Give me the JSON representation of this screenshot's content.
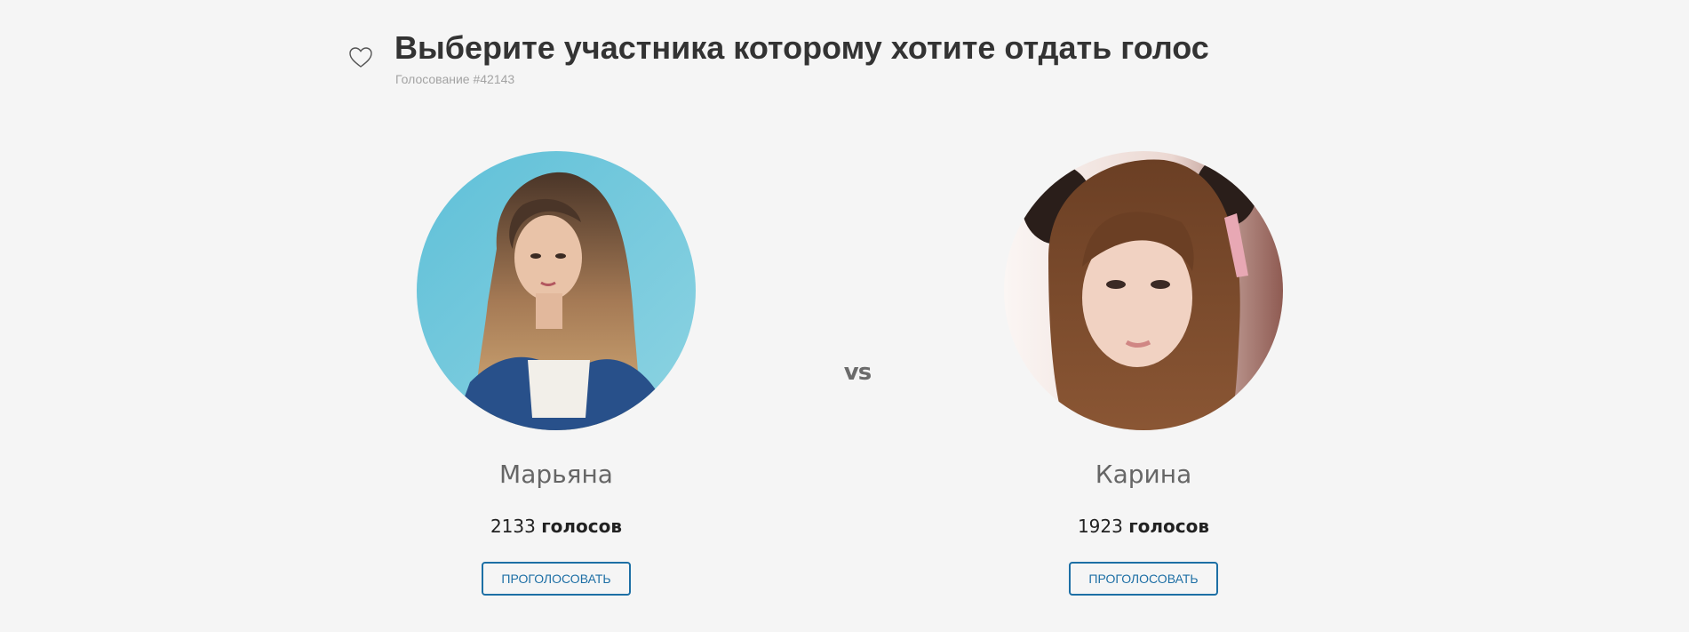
{
  "header": {
    "title": "Выберите участника которому хотите отдать голос",
    "subtitle": "Голосование #42143",
    "icon": "heart-outline-icon"
  },
  "vs_label": "vs",
  "candidates": [
    {
      "name": "Марьяна",
      "vote_count": "2133",
      "votes_word": "голосов",
      "button_label": "ПРОГОЛОСОВАТЬ"
    },
    {
      "name": "Карина",
      "vote_count": "1923",
      "votes_word": "голосов",
      "button_label": "ПРОГОЛОСОВАТЬ"
    }
  ],
  "colors": {
    "background": "#f5f5f5",
    "button_accent": "#1d6fa5",
    "title": "#333333",
    "subtitle": "#a3a3a3"
  }
}
